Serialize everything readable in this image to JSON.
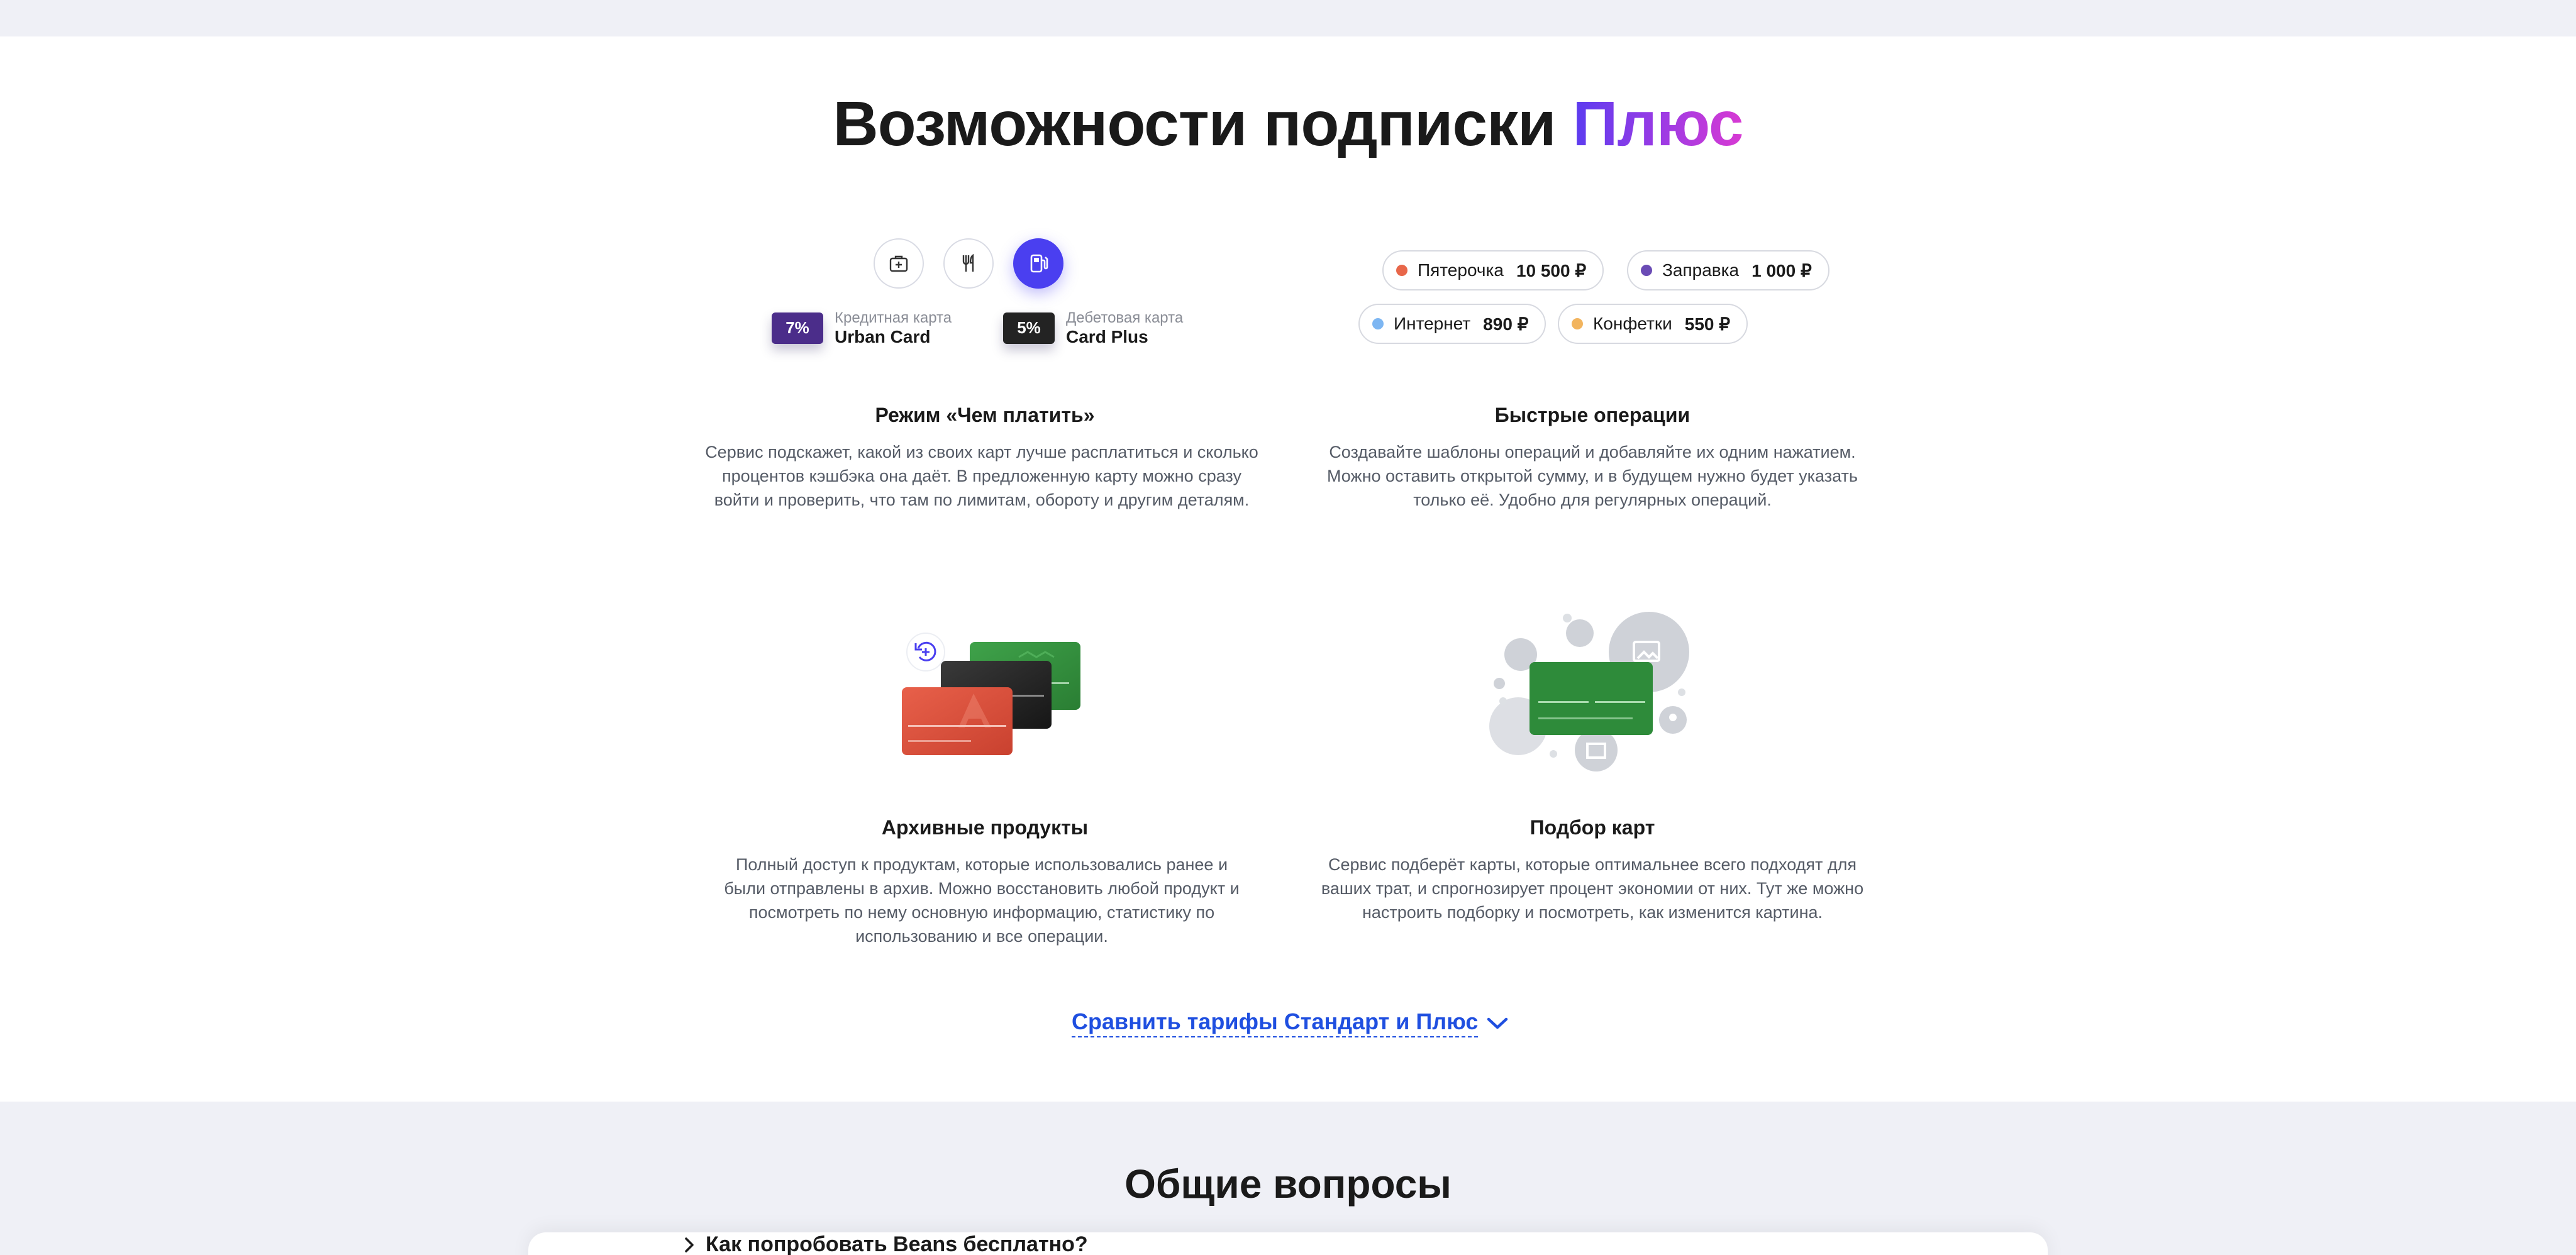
{
  "section": {
    "title_main": "Возможности подписки",
    "title_accent": "Плюс"
  },
  "features": [
    {
      "title": "Режим «Чем платить»",
      "description": "Сервис подскажет, какой из своих карт лучше расплатиться и сколько процентов кэшбэка она даёт. В предложенную карту можно сразу войти и проверить, что там по лимитам, обороту и другим деталям.",
      "icons": [
        "medkit-icon",
        "cutlery-icon",
        "fuel-icon"
      ],
      "active_icon": "fuel-icon",
      "cards": [
        {
          "percent": "7%",
          "type": "Кредитная карта",
          "name": "Urban Card",
          "badge_color": "#4b2d8a"
        },
        {
          "percent": "5%",
          "type": "Дебетовая карта",
          "name": "Card Plus",
          "badge_color": "#232323"
        }
      ]
    },
    {
      "title": "Быстрые операции",
      "description": "Создавайте шаблоны операций и добавляйте их одним нажатием. Можно оставить открытой сумму, и в будущем нужно будет указать только её. Удобно для регулярных операций.",
      "templates": [
        {
          "label": "Пятерочка",
          "amount": "10 500 ₽",
          "color": "#e8674a"
        },
        {
          "label": "Заправка",
          "amount": "1 000 ₽",
          "color": "#6a4bb5"
        },
        {
          "label": "Интернет",
          "amount": "890 ₽",
          "color": "#7db6f2"
        },
        {
          "label": "Конфетки",
          "amount": "550 ₽",
          "color": "#f2b45e"
        }
      ]
    },
    {
      "title": "Архивные продукты",
      "description": "Полный доступ к продуктам, которые использовались ранее и были отправлены в архив. Можно восстановить любой продукт и посмотреть по нему основную информацию, статистику по использованию и все операции."
    },
    {
      "title": "Подбор карт",
      "description": "Сервис подберёт карты, которые оптимальнее всего подходят для ваших трат, и спрогнозирует процент экономии от них. Тут же можно настроить подборку и посмотреть, как изменится картина."
    }
  ],
  "compare_link": "Сравнить тарифы Стандарт и Плюс",
  "faq": {
    "title": "Общие вопросы",
    "first_question": "Как попробовать Beans бесплатно?"
  },
  "colors": {
    "accent_blue": "#1f4fe0",
    "active_icon": "#4a3ff0",
    "band_background": "#eff0f6"
  }
}
